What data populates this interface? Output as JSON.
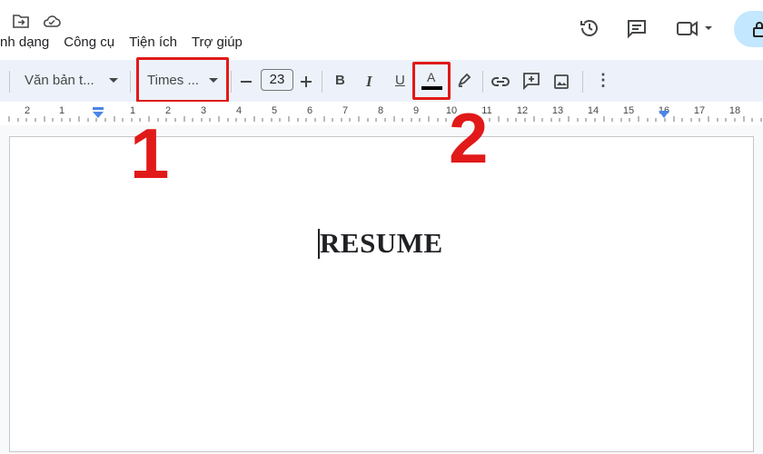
{
  "menu": {
    "items": [
      "nh dạng",
      "Công cụ",
      "Tiện ích",
      "Trợ giúp"
    ]
  },
  "toolbar": {
    "style_label": "Văn bản t...",
    "font_label": "Times ...",
    "font_size": "23",
    "bold": "B",
    "italic": "I",
    "underline": "U",
    "text_color": "A",
    "more": "⋮"
  },
  "ruler": {
    "marks": [
      "2",
      "1",
      "1",
      "2",
      "3",
      "4",
      "5",
      "6",
      "7",
      "8",
      "9",
      "10",
      "11",
      "12",
      "13",
      "14",
      "15",
      "16",
      "17",
      "18"
    ]
  },
  "annotations": {
    "step1": "1",
    "step2": "2"
  },
  "document": {
    "text": "RESUME"
  },
  "colors": {
    "annotation_red": "#e11919",
    "toolbar_bg": "#edf2fa",
    "text_color_bar": "#000000"
  }
}
